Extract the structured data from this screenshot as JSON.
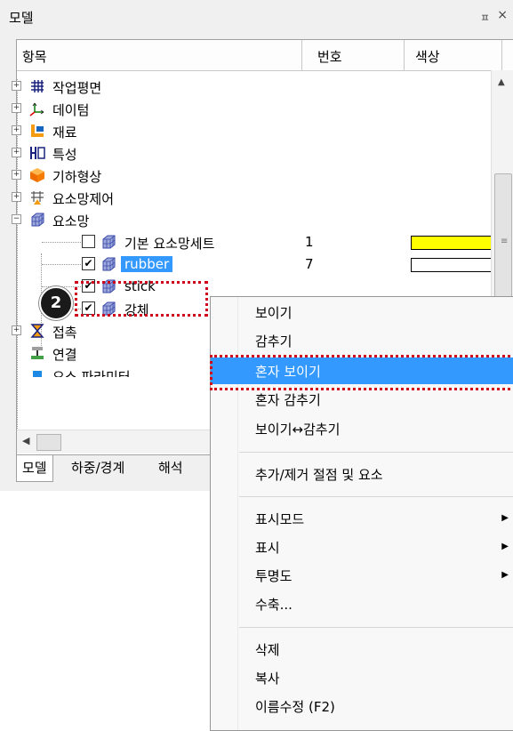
{
  "panel": {
    "title": "모델",
    "pin": "ㅍ",
    "close": "×"
  },
  "header": {
    "col_item": "항목",
    "col_num": "번호",
    "col_color": "색상"
  },
  "tree": [
    {
      "label": "작업평면",
      "icon": "grid-icon"
    },
    {
      "label": "데이텀",
      "icon": "axes-icon"
    },
    {
      "label": "재료",
      "icon": "material-icon"
    },
    {
      "label": "특성",
      "icon": "property-icon"
    },
    {
      "label": "기하형상",
      "icon": "geometry-cube-icon"
    },
    {
      "label": "요소망제어",
      "icon": "mesh-control-icon"
    },
    {
      "label": "요소망",
      "icon": "mesh-icon"
    }
  ],
  "mesh_children": [
    {
      "label": "기본 요소망세트",
      "checked": false,
      "num": "1",
      "swatch": "#ffff00"
    },
    {
      "label": "rubber",
      "checked": true,
      "num": "7",
      "swatch": "#ffffff"
    },
    {
      "label": "stick",
      "checked": true,
      "num": "",
      "swatch": ""
    },
    {
      "label": "강체",
      "checked": true,
      "num": "",
      "swatch": ""
    }
  ],
  "tree_tail": [
    {
      "label": "접촉",
      "icon": "contact-icon"
    },
    {
      "label": "연결",
      "icon": "connection-icon"
    },
    {
      "label": "요소 파라미터",
      "icon": "parameter-icon"
    }
  ],
  "tabs": {
    "model": "모델",
    "load": "하중/경계",
    "analysis": "해석"
  },
  "badge": "2",
  "context_menu": {
    "show": "보이기",
    "hide": "감추기",
    "show_only": "혼자 보이기",
    "hide_only": "혼자 감추기",
    "toggle": "보이기↔감추기",
    "add_remove": "추가/제거 절점 및 요소",
    "display_mode": "표시모드",
    "display": "표시",
    "transparency": "투명도",
    "shrink": "수축...",
    "delete": "삭제",
    "copy": "복사",
    "rename": "이름수정 (F2)"
  },
  "colors": {
    "selection": "#3399ff",
    "callout": "#d0021b",
    "default_set": "#ffff00"
  }
}
